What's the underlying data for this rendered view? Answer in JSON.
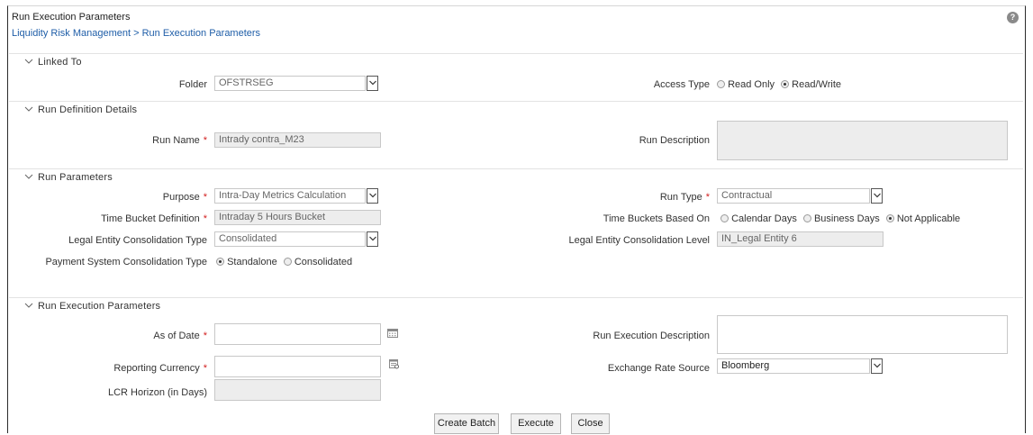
{
  "header": {
    "title": "Run Execution Parameters",
    "breadcrumb": "Liquidity Risk Management > Run Execution Parameters",
    "help_icon": "?"
  },
  "sections": {
    "linked_to": "Linked To",
    "run_definition": "Run Definition Details",
    "run_parameters": "Run Parameters",
    "run_execution": "Run Execution Parameters"
  },
  "linked_to": {
    "folder_label": "Folder",
    "folder_value": "OFSTRSEG",
    "access_type_label": "Access Type",
    "access_options": [
      "Read Only",
      "Read/Write"
    ],
    "access_selected": "Read/Write"
  },
  "run_definition": {
    "run_name_label": "Run Name",
    "run_name_value": "Intrady contra_M23",
    "run_description_label": "Run Description",
    "run_description_value": ""
  },
  "run_parameters": {
    "purpose_label": "Purpose",
    "purpose_value": "Intra-Day Metrics Calculation",
    "run_type_label": "Run Type",
    "run_type_value": "Contractual",
    "time_bucket_label": "Time Bucket Definition",
    "time_bucket_value": "Intraday 5 Hours Bucket",
    "time_buckets_based_label": "Time Buckets Based On",
    "time_buckets_options": [
      "Calendar Days",
      "Business Days",
      "Not Applicable"
    ],
    "time_buckets_selected": "Not Applicable",
    "le_cons_type_label": "Legal Entity Consolidation Type",
    "le_cons_type_value": "Consolidated",
    "le_cons_level_label": "Legal Entity Consolidation Level",
    "le_cons_level_value": "IN_Legal Entity 6",
    "payment_cons_label": "Payment System Consolidation Type",
    "payment_options": [
      "Standalone",
      "Consolidated"
    ],
    "payment_selected": "Standalone"
  },
  "run_execution": {
    "as_of_date_label": "As of Date",
    "as_of_date_value": "",
    "run_exec_desc_label": "Run Execution Description",
    "run_exec_desc_value": "",
    "reporting_currency_label": "Reporting Currency",
    "reporting_currency_value": "",
    "exchange_rate_label": "Exchange Rate Source",
    "exchange_rate_value": "Bloomberg",
    "lcr_horizon_label": "LCR Horizon (in Days)",
    "lcr_horizon_value": ""
  },
  "actions": {
    "create_batch": "Create Batch",
    "execute": "Execute",
    "close": "Close"
  },
  "required_marker": "*",
  "colors": {
    "link": "#1f5ea8",
    "required": "#d21f1f",
    "readonly_bg": "#ededed"
  }
}
